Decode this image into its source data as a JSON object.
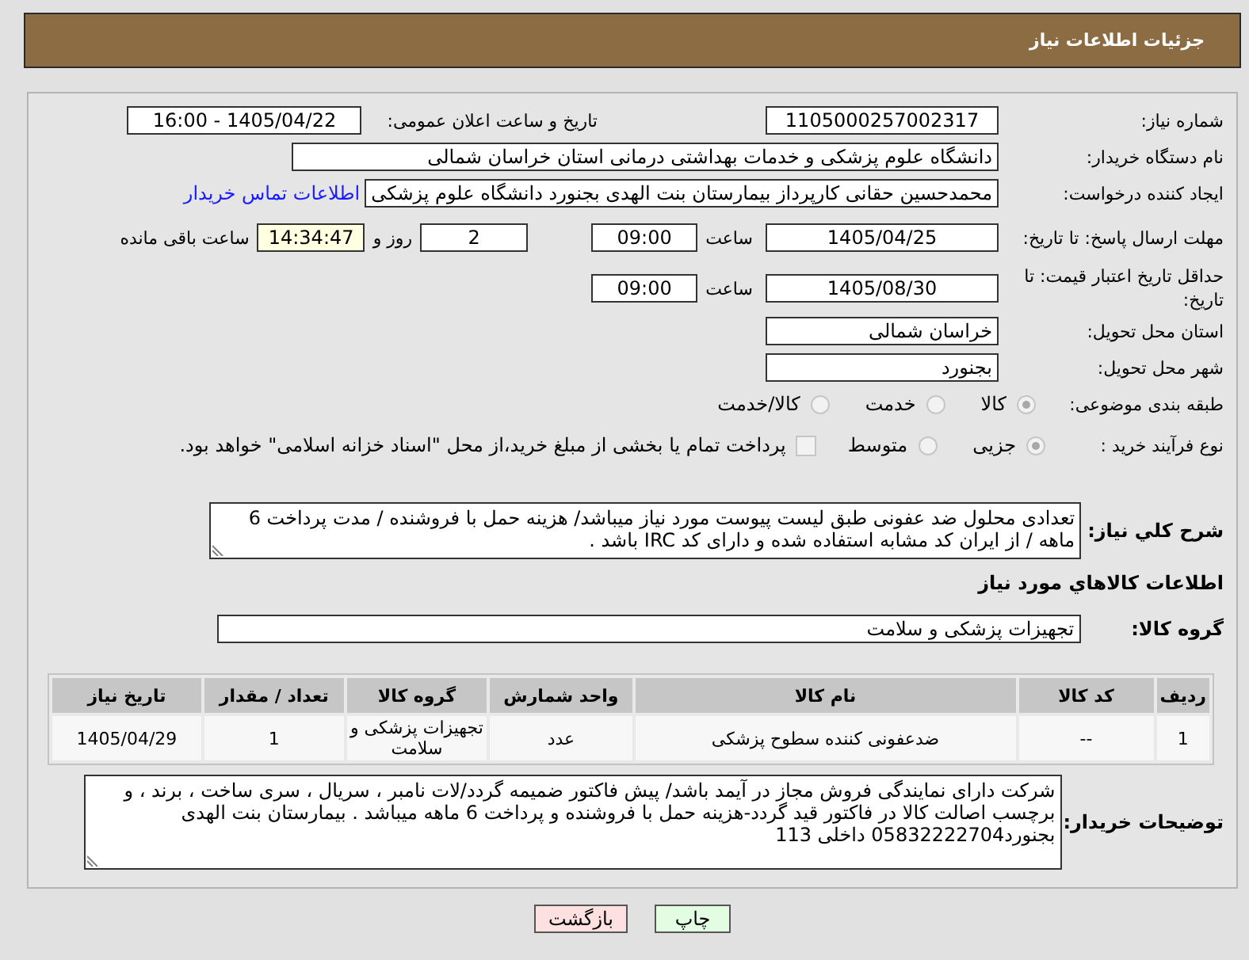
{
  "window": {
    "title": "جزئیات اطلاعات نیاز"
  },
  "details": {
    "need_number": {
      "label": "شماره نیاز:",
      "value": "1105000257002317"
    },
    "announcement": {
      "label": "تاریخ و ساعت اعلان عمومی:",
      "value": "1405/04/22 - 16:00"
    },
    "buyer_organization": {
      "label": "نام دستگاه خریدار:",
      "value": "دانشگاه علوم پزشکی و خدمات بهداشتی درمانی استان خراسان شمالی"
    },
    "requester": {
      "label": "ایجاد کننده درخواست:",
      "value": "محمدحسین حقانی کارپرداز بیمارستان بنت الهدی بجنورد دانشگاه علوم پزشکی",
      "link": "اطلاعات تماس خریدار"
    },
    "response_deadline": {
      "label": "مهلت ارسال پاسخ: تا تاریخ:",
      "date": "1405/04/25",
      "time_label": "ساعت",
      "time": "09:00",
      "days": "2",
      "days_label": "روز و",
      "remaining": "14:34:47",
      "remaining_label": "ساعت باقی مانده"
    },
    "price_validity": {
      "label": "حداقل تاریخ اعتبار قیمت: تا تاریخ:",
      "date": "1405/08/30",
      "time_label": "ساعت",
      "time": "09:00"
    },
    "delivery_province": {
      "label": "استان محل تحویل:",
      "value": "خراسان شمالی"
    },
    "delivery_city": {
      "label": "شهر محل تحویل:",
      "value": "بجنورد"
    },
    "subject_category": {
      "label": "طبقه بندی موضوعی:",
      "options": [
        {
          "label": "کالا",
          "selected": true,
          "disabled": true
        },
        {
          "label": "خدمت",
          "selected": false,
          "disabled": true
        },
        {
          "label": "کالا/خدمت",
          "selected": false,
          "disabled": true
        }
      ]
    },
    "purchase_process": {
      "label": "نوع فرآیند خرید :",
      "options": [
        {
          "label": "جزیی",
          "selected": true,
          "disabled": true
        },
        {
          "label": "متوسط",
          "selected": false,
          "disabled": true
        }
      ],
      "treasury_payment": {
        "label": "پرداخت تمام یا بخشی از مبلغ خرید،از محل \"اسناد خزانه اسلامی\" خواهد بود.",
        "checked": false,
        "disabled": true
      }
    }
  },
  "description": {
    "label": "شرح کلي نیاز:",
    "value": "تعدادی محلول ضد عفونی طبق لیست پیوست مورد نیاز میباشد/ هزینه حمل با فروشنده  / مدت پرداخت 6 ماهه / از ایران کد مشابه استفاده شده و دارای کد IRC باشد ."
  },
  "items_section": {
    "title": "اطلاعات کالاهاي مورد نیاز",
    "group": {
      "label": "گروه کالا:",
      "value": "تجهیزات پزشکی و سلامت"
    },
    "table": {
      "columns": [
        "ردیف",
        "کد کالا",
        "نام کالا",
        "واحد شمارش",
        "گروه کالا",
        "تعداد / مقدار",
        "تاریخ نیاز"
      ],
      "rows": [
        [
          "1",
          "--",
          "ضدعفونی کننده سطوح پزشکی",
          "عدد",
          "تجهیزات پزشکی و سلامت",
          "1",
          "1405/04/29"
        ]
      ]
    }
  },
  "buyer_notes": {
    "label": "توضیحات خریدار:",
    "value": "شرکت دارای نمایندگی فروش مجاز در آیمد باشد/ پیش فاکتور ضمیمه گردد/لات نامبر ، سریال ، سری ساخت ، برند ، و برچسب اصالت کالا در فاکتور قید گردد-هزینه حمل با فروشنده و پرداخت 6 ماهه میباشد . بیمارستان بنت الهدی بجنورد05832222704 داخلی 113"
  },
  "buttons": [
    {
      "label": "چاپ",
      "kind": "print"
    },
    {
      "label": "بازگشت",
      "kind": "back"
    }
  ]
}
